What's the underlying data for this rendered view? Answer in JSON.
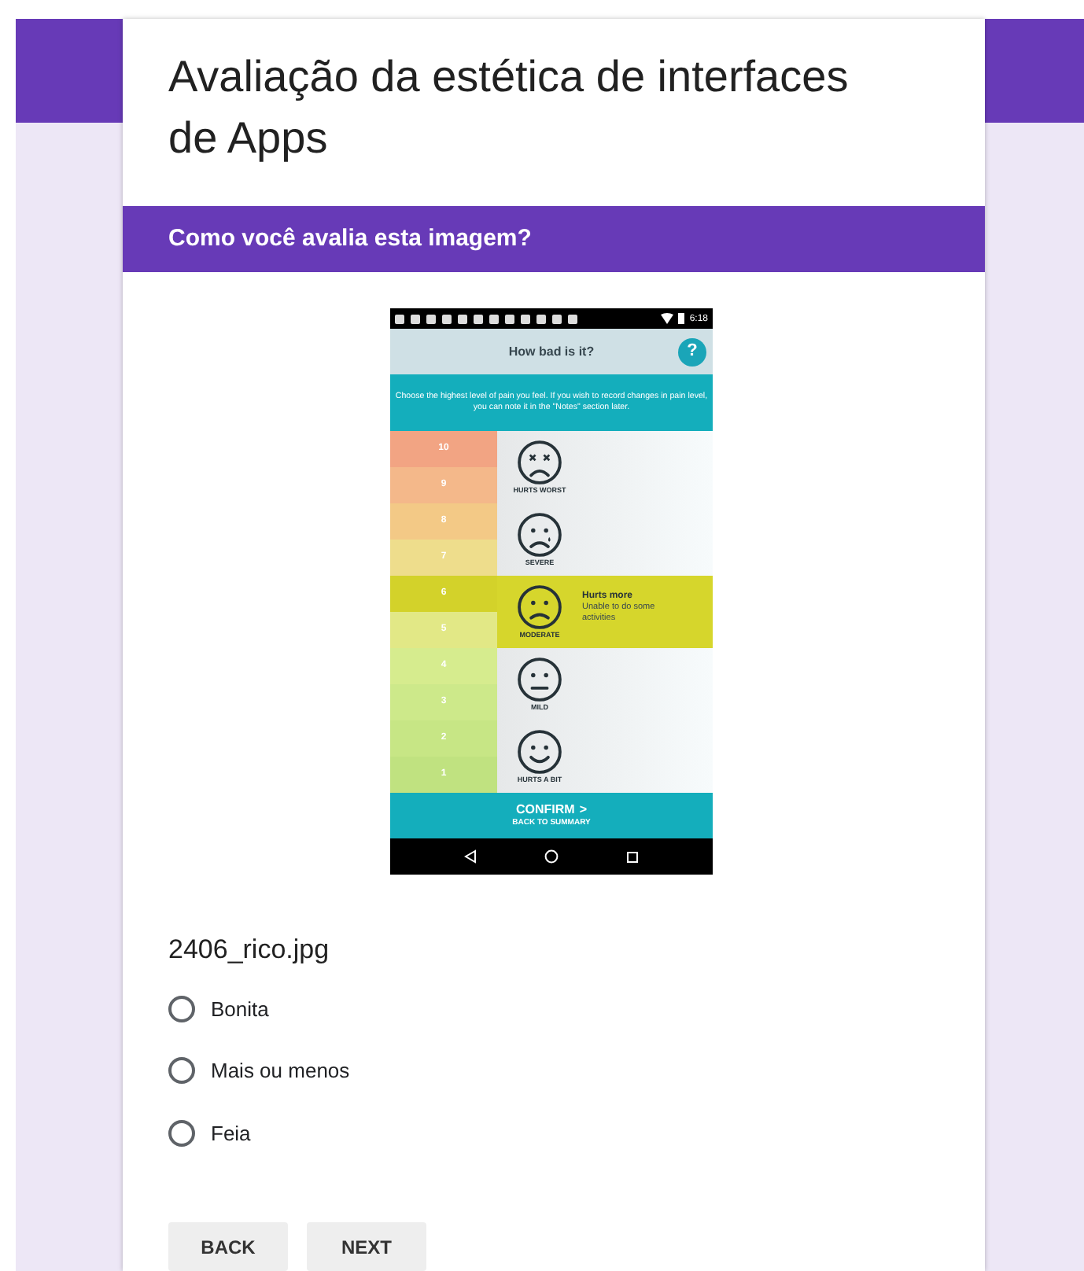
{
  "form": {
    "title": "Avaliação da estética de interfaces de Apps"
  },
  "section": {
    "title": "Como você avalia esta imagem?"
  },
  "app_screen": {
    "status_time": "6:18",
    "header_title": "How bad is it?",
    "help_symbol": "?",
    "instruction": "Choose the highest level of pain you feel. If you wish to record changes in pain level, you can note it in the \"Notes\" section later.",
    "levels": [
      {
        "number": "10",
        "color": "#f2a483"
      },
      {
        "number": "9",
        "color": "#f4b88a"
      },
      {
        "number": "8",
        "color": "#f3c986"
      },
      {
        "number": "7",
        "color": "#eedd8c"
      },
      {
        "number": "6",
        "color": "#d3d22a"
      },
      {
        "number": "5",
        "color": "#e2e886"
      },
      {
        "number": "4",
        "color": "#d6ec8e"
      },
      {
        "number": "3",
        "color": "#cde98a"
      },
      {
        "number": "2",
        "color": "#c7e685"
      },
      {
        "number": "1",
        "color": "#c0e280"
      }
    ],
    "categories": [
      {
        "kind": "worst",
        "label": "HURTS WORST",
        "selected": false
      },
      {
        "kind": "tearful",
        "label": "SEVERE",
        "selected": false
      },
      {
        "kind": "sad",
        "label": "MODERATE",
        "selected": true,
        "title": "Hurts more",
        "description": "Unable to do some activities"
      },
      {
        "kind": "neutral",
        "label": "MILD",
        "selected": false
      },
      {
        "kind": "smile",
        "label": "HURTS A BIT",
        "selected": false
      }
    ],
    "confirm_button": "CONFIRM",
    "confirm_symbol": ">",
    "back_link": "BACK TO SUMMARY"
  },
  "image_caption": "2406_rico.jpg",
  "options": [
    {
      "label": "Bonita",
      "selected": false
    },
    {
      "label": "Mais ou menos",
      "selected": false
    },
    {
      "label": "Feia",
      "selected": false
    }
  ],
  "buttons": [
    "BACK",
    "NEXT"
  ]
}
